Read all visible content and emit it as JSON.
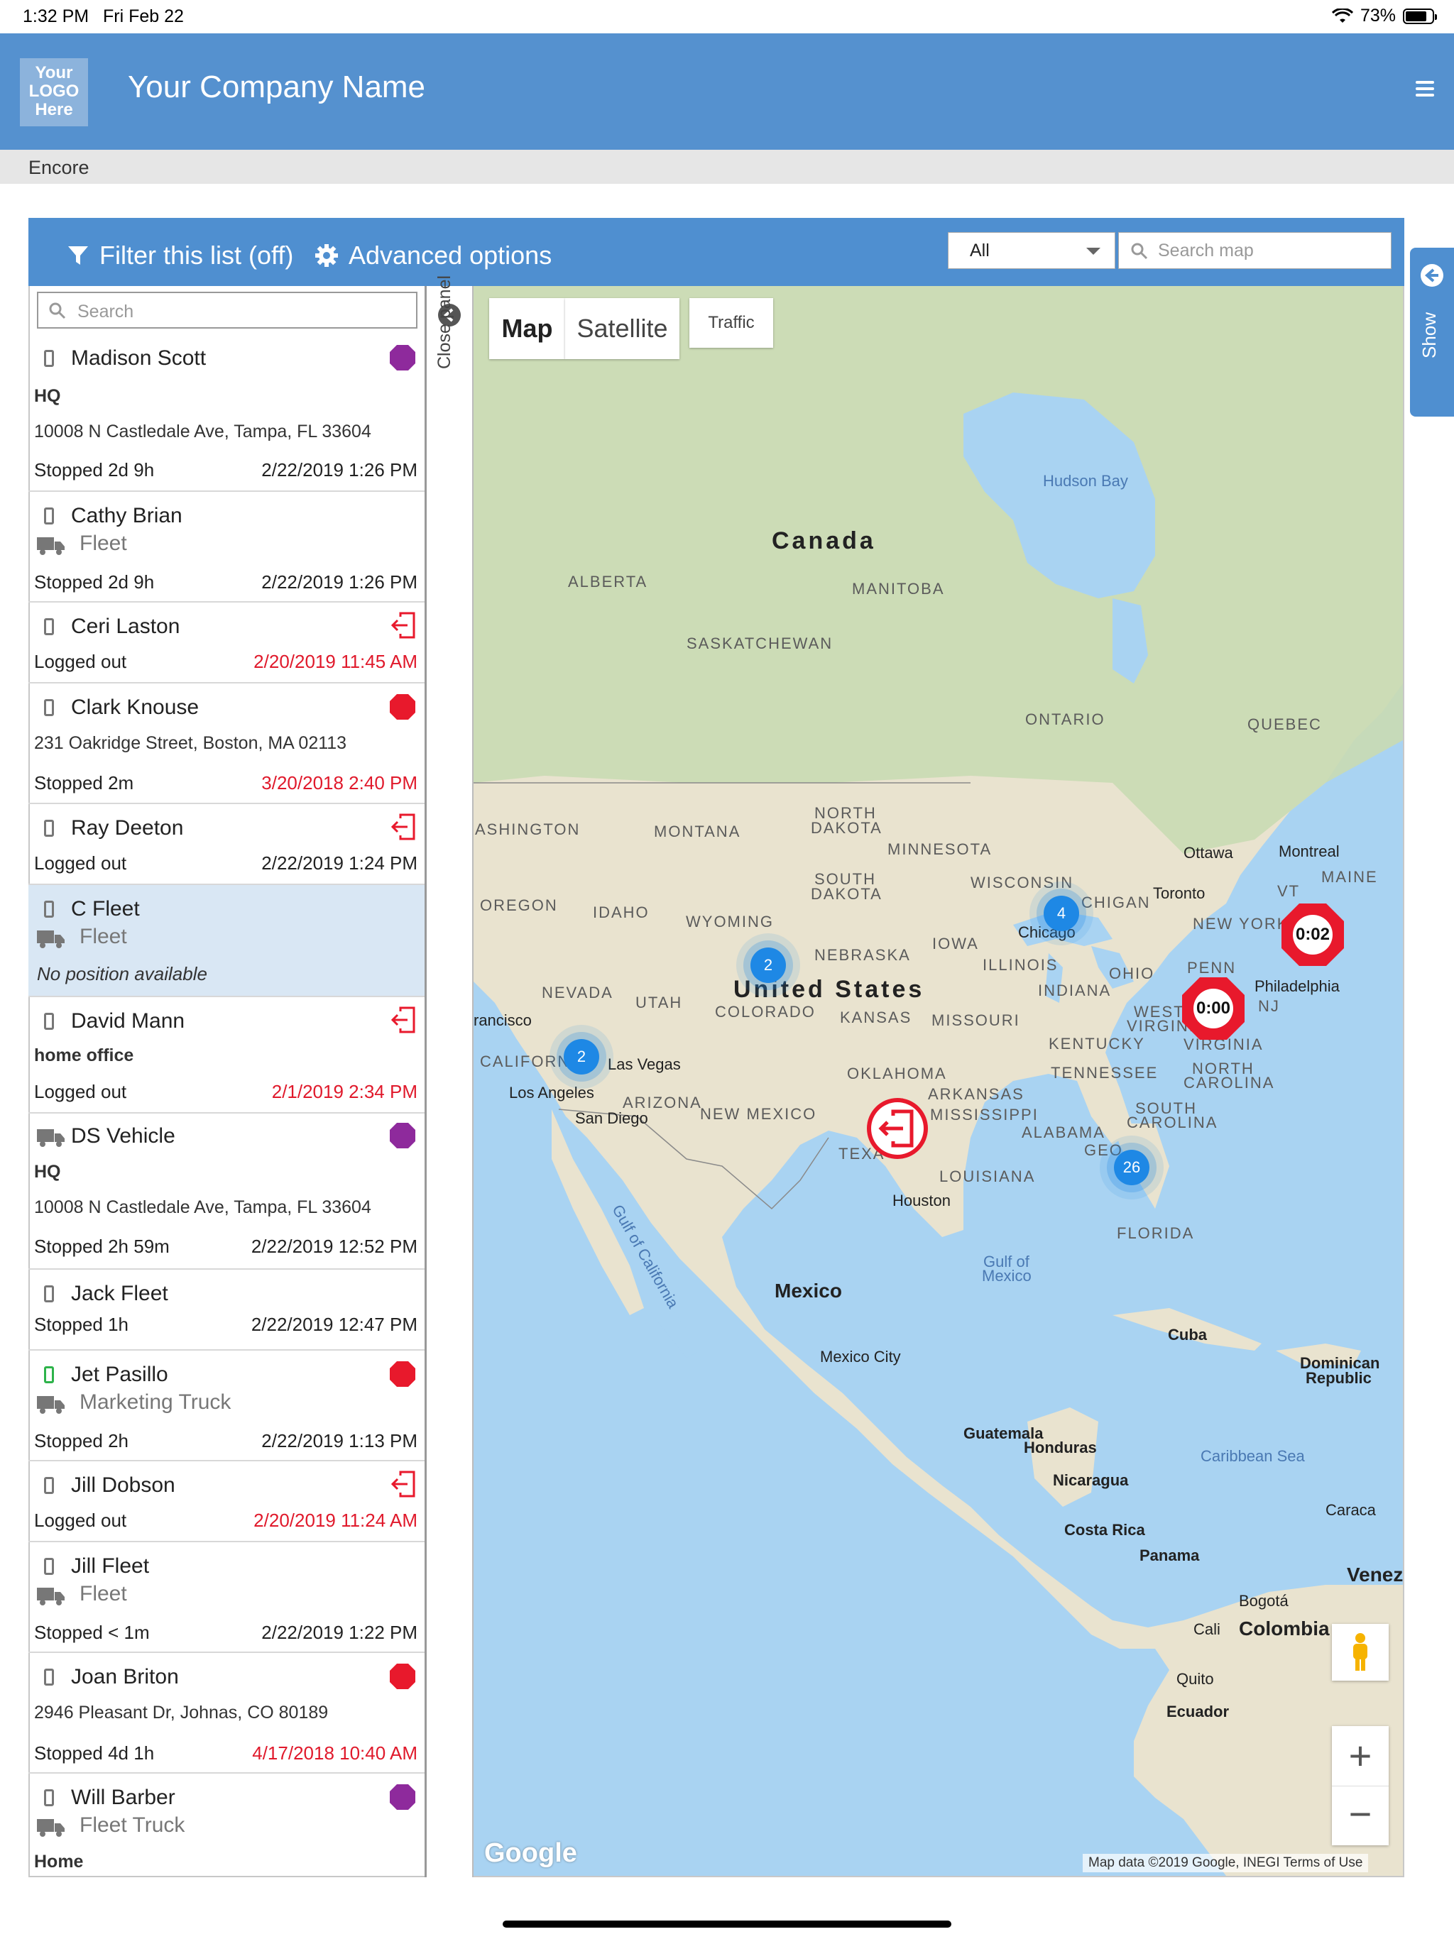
{
  "status_bar": {
    "time": "1:32 PM",
    "date": "Fri Feb 22",
    "battery": "73%"
  },
  "header": {
    "logo_text": [
      "Your",
      "LOGO",
      "Here"
    ],
    "company_name": "Your Company Name"
  },
  "subbar": {
    "title": "Encore"
  },
  "toolbar": {
    "filter_label": "Filter this list (off)",
    "advanced_label": "Advanced options",
    "select_value": "All",
    "search_map_placeholder": "Search map"
  },
  "list": {
    "search_placeholder": "Search",
    "items": [
      {
        "name": "Madison Scott",
        "place": "HQ",
        "address": "10008 N Castledale Ave,  Tampa, FL 33604",
        "status": "Stopped 2d 9h",
        "time": "2/22/2019 1:26 PM"
      },
      {
        "name": "Cathy Brian",
        "group": "Fleet",
        "status": "Stopped 2d 9h",
        "time": "2/22/2019 1:26 PM"
      },
      {
        "name": "Ceri Laston",
        "status": "Logged out",
        "time": "2/20/2019 11:45 AM"
      },
      {
        "name": "Clark Knouse",
        "address": "231 Oakridge Street, Boston, MA 02113",
        "status": "Stopped 2m",
        "time": "3/20/2018 2:40 PM"
      },
      {
        "name": "Ray Deeton",
        "status": "Logged out",
        "time": "2/22/2019 1:24 PM"
      },
      {
        "name": "C Fleet",
        "group": "Fleet",
        "note": "No position available"
      },
      {
        "name": "David Mann",
        "place": "home office",
        "status": "Logged out",
        "time": "2/1/2019 2:34 PM"
      },
      {
        "name": "DS Vehicle",
        "place": "HQ",
        "address": "10008 N Castledale Ave,  Tampa, FL 33604",
        "status": "Stopped 2h 59m",
        "time": "2/22/2019 12:52 PM"
      },
      {
        "name": "Jack Fleet",
        "status": "Stopped 1h",
        "time": "2/22/2019 12:47 PM"
      },
      {
        "name": "Jet Pasillo",
        "group": "Marketing Truck",
        "status": "Stopped 2h",
        "time": "2/22/2019 1:13 PM"
      },
      {
        "name": "Jill  Dobson",
        "status": "Logged out",
        "time": "2/20/2019 11:24 AM"
      },
      {
        "name": "Jill Fleet",
        "group": "Fleet",
        "status": "Stopped < 1m",
        "time": "2/22/2019 1:22 PM"
      },
      {
        "name": "Joan Briton",
        "address": "2946  Pleasant Dr,  Johnas, CO 80189",
        "status": "Stopped 4d 1h",
        "time": "4/17/2018 10:40 AM"
      },
      {
        "name": "Will Barber",
        "group": "Fleet Truck",
        "place": "Home"
      }
    ]
  },
  "close_panel_label": "Close panel",
  "map": {
    "type_buttons": {
      "map": "Map",
      "satellite": "Satellite",
      "traffic": "Traffic"
    },
    "countries": {
      "canada": "Canada",
      "us": "United States",
      "mexico": "Mexico",
      "cuba": "Cuba",
      "dominican": "Dominican",
      "republic": "Republic",
      "guatemala": "Guatemala",
      "honduras": "Honduras",
      "nicaragua": "Nicaragua",
      "costa_rica": "Costa Rica",
      "panama": "Panama",
      "colombia": "Colombia",
      "ecuador": "Ecuador",
      "venez": "Venez"
    },
    "regions": {
      "alberta": "ALBERTA",
      "manitoba": "MANITOBA",
      "saskatchewan": "SASKATCHEWAN",
      "ontario": "ONTARIO",
      "quebec": "QUEBEC",
      "washington": "ASHINGTON",
      "montana": "MONTANA",
      "north_dakota_1": "NORTH",
      "north_dakota_2": "DAKOTA",
      "minnesota": "MINNESOTA",
      "south_dakota_1": "SOUTH",
      "south_dakota_2": "DAKOTA",
      "wisconsin": "WISCONSIN",
      "michigan": "CHIGAN",
      "oregon": "OREGON",
      "idaho": "IDAHO",
      "wyoming": "WYOMING",
      "nebraska": "NEBRASKA",
      "iowa": "IOWA",
      "illinois": "ILLINOIS",
      "indiana": "INDIANA",
      "ohio": "OHIO",
      "penn": "PENN",
      "new_york": "NEW YORK",
      "vt": "VT",
      "maine": "MAINE",
      "nevada": "NEVADA",
      "utah": "UTAH",
      "colorado": "COLORADO",
      "kansas": "KANSAS",
      "missouri": "MISSOURI",
      "west_virginia_1": "WEST",
      "west_virginia_2": "VIRGINIA",
      "virginia": "VIRGINIA",
      "nj": "NJ",
      "kentucky": "KENTUCKY",
      "california": "CALIFORN",
      "oklahoma": "OKLAHOMA",
      "arkansas": "ARKANSAS",
      "tennessee": "TENNESSEE",
      "north_carolina_1": "NORTH",
      "north_carolina_2": "CAROLINA",
      "arizona": "ARIZONA",
      "new_mexico": "NEW MEXICO",
      "mississippi": "MISSISSIPPI",
      "alabama": "ALABAMA",
      "south_carolina_1": "SOUTH",
      "south_carolina_2": "CAROLINA",
      "texas": "TEXA",
      "georgia": "GEO",
      "louisiana": "LOUISIANA",
      "florida": "FLORIDA"
    },
    "cities": {
      "ottawa": "Ottawa",
      "montreal": "Montreal",
      "toronto": "Toronto",
      "chicago": "Chicago",
      "philadelphia": "Philadelphia",
      "francisco": "rancisco",
      "las_vegas": "Las Vegas",
      "los_angeles": "Los Angeles",
      "san_diego": "San Diego",
      "houston": "Houston",
      "mexico_city": "Mexico City",
      "bogota": "Bogotá",
      "cali": "Cali",
      "quito": "Quito",
      "caracas": "Caraca"
    },
    "water": {
      "hudson_bay": "Hudson Bay",
      "gulf_mexico_1": "Gulf of",
      "gulf_mexico_2": "Mexico",
      "gulf_california": "Gulf of California",
      "caribbean": "Caribbean Sea"
    },
    "clusters": {
      "chicago": "4",
      "colorado": "2",
      "california": "2",
      "florida": "26"
    },
    "stop_signs": {
      "ny": "0:02",
      "va": "0:00"
    },
    "google": "Google",
    "attribution": "Map data ©2019 Google, INEGI   Terms of Use"
  },
  "show_label": "Show",
  "colors": {
    "header": "#5591cf",
    "toolbar": "#4f8fd0",
    "stop_red": "#e8192c",
    "purple": "#8e2a9c",
    "cluster": "#1e88e5",
    "green": "#2db34a"
  }
}
